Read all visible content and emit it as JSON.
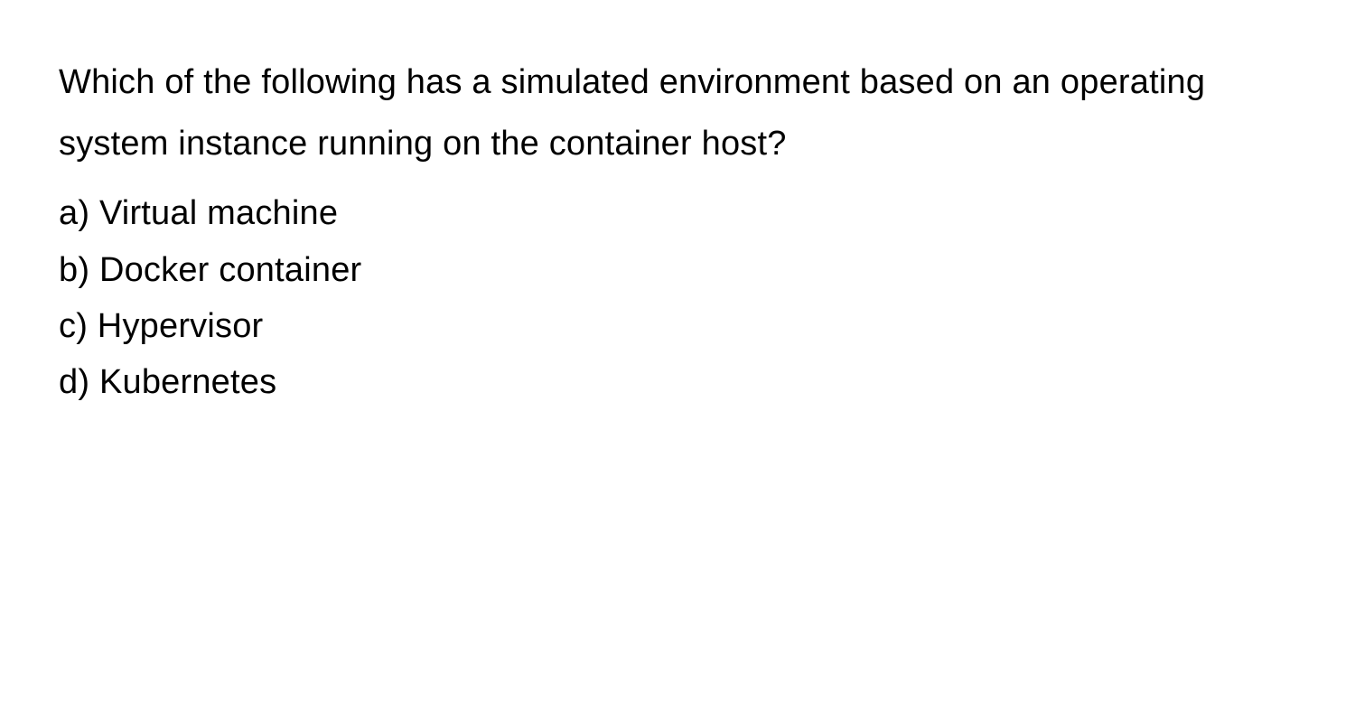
{
  "question": {
    "text": "Which of the following has a simulated environment based on an operating system instance running on the container host?",
    "options": {
      "a": "a) Virtual machine",
      "b": "b) Docker container",
      "c": "c) Hypervisor",
      "d": "d) Kubernetes"
    }
  }
}
